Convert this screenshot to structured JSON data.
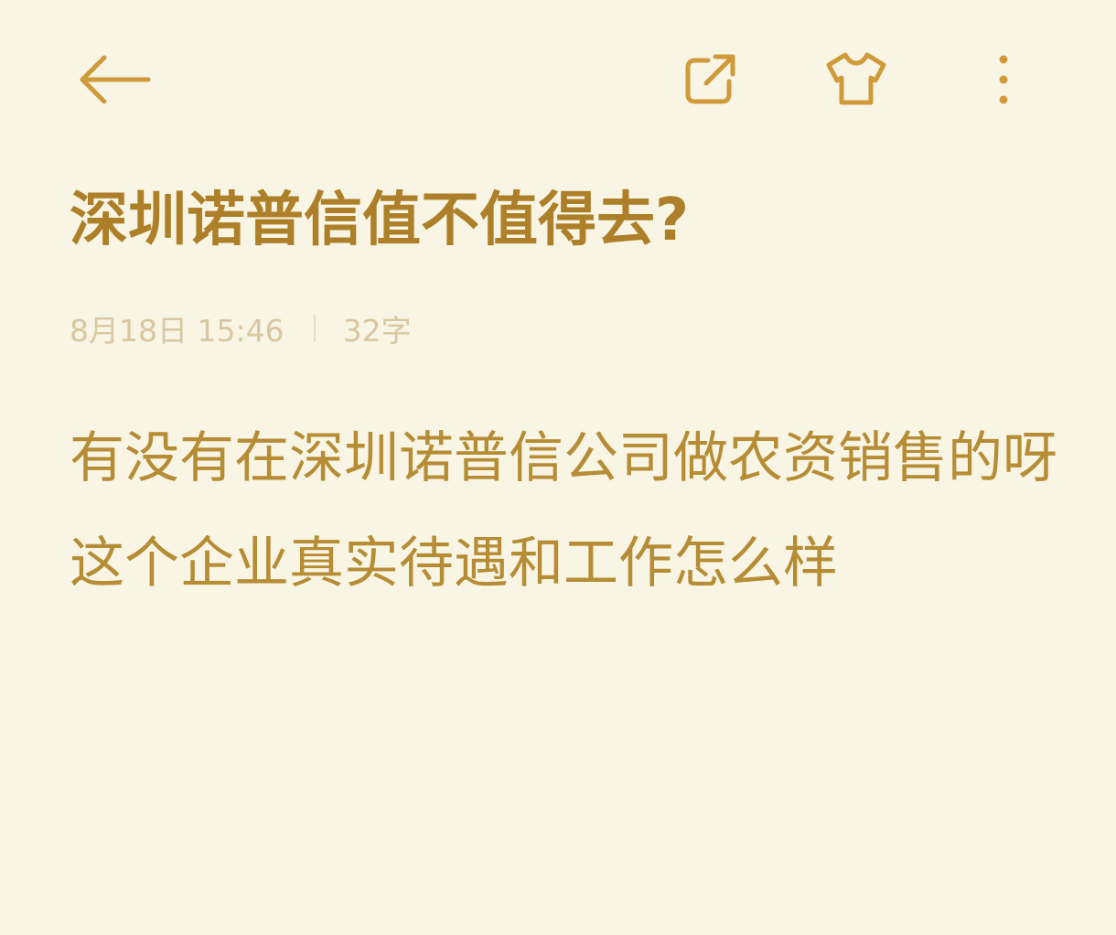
{
  "toolbar": {
    "icons": {
      "back": "back-arrow-icon",
      "share": "share-icon",
      "skin": "tshirt-theme-icon",
      "more": "more-vertical-icon"
    },
    "icon_color": "#d09a3a"
  },
  "note": {
    "title": "深圳诺普信值不值得去?",
    "date": "8月18日 15:46",
    "word_count": "32字",
    "body": [
      "有没有在深圳诺普信公司做农资销售的呀",
      "这个企业真实待遇和工作怎么样"
    ]
  },
  "colors": {
    "background": "#f8f5e4",
    "title": "#ad7f28",
    "body_text": "#b68c35",
    "meta_text": "#d8c7a0"
  }
}
